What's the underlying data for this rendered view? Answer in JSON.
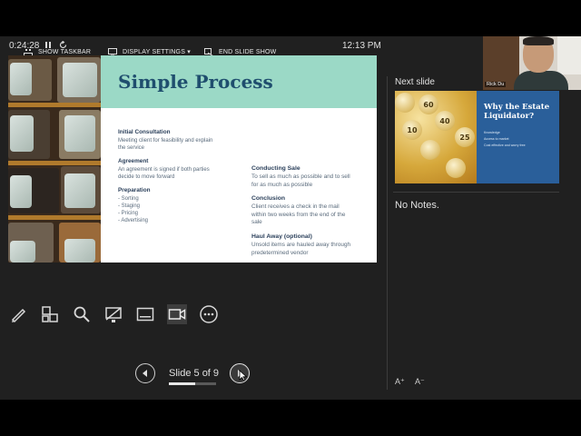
{
  "toolbar": {
    "show_taskbar": "SHOW TASKBAR",
    "display_settings": "DISPLAY SETTINGS ▾",
    "end_slide_show": "END SLIDE SHOW"
  },
  "status": {
    "timer": "0:24:28",
    "clock": "12:13 PM"
  },
  "current_slide": {
    "title": "Simple Process",
    "left_items": [
      {
        "heading": "Initial Consultation",
        "lines": [
          "Meeting client for feasibility and explain",
          "the service"
        ]
      },
      {
        "heading": "Agreement",
        "lines": [
          "An agreement is signed if both parties",
          "decide to move forward"
        ]
      },
      {
        "heading": "Preparation",
        "lines": [
          "- Sorting",
          "- Staging",
          "- Pricing",
          "- Advertising"
        ]
      }
    ],
    "right_items": [
      {
        "heading": "Conducting Sale",
        "lines": [
          "To sell as much as possible and to sell",
          "for as much as possible"
        ]
      },
      {
        "heading": "Conclusion",
        "lines": [
          "Client receives a check in the mail",
          "within two weeks from the end  of the",
          "sale"
        ]
      },
      {
        "heading": "Haul Away (optional)",
        "lines": [
          "Unsold items are hauled away through",
          "predetermined vendor"
        ]
      }
    ]
  },
  "tools": [
    "pen-icon",
    "slides-grid-icon",
    "zoom-icon",
    "laser-pointer-icon",
    "subtitles-icon",
    "camera-icon",
    "more-icon"
  ],
  "navigation": {
    "slide_counter": "Slide 5 of 9",
    "progress": 0.556
  },
  "next_panel": {
    "label": "Next slide",
    "slide_title": "Why the Estate Liquidator?",
    "bullets": [
      "Knowledge",
      "Access to market",
      "Cost effective and worry free"
    ],
    "keys": [
      "60",
      "40",
      "25",
      "10"
    ]
  },
  "notes": {
    "text": "No Notes."
  },
  "font_buttons": {
    "increase": "A⁺",
    "decrease": "A⁻"
  },
  "video": {
    "name": "Rick Du"
  }
}
